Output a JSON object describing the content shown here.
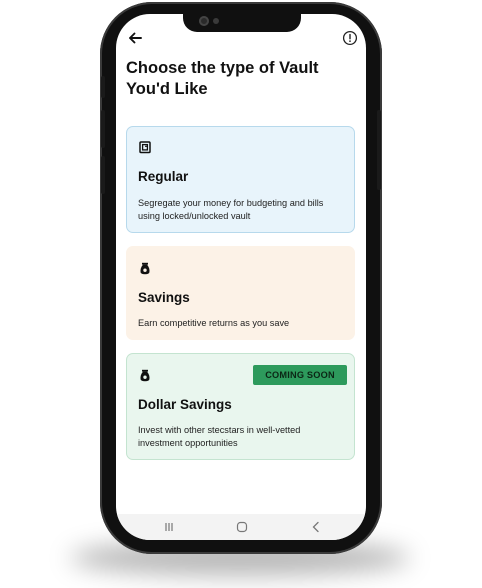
{
  "header": {
    "back_icon": "arrow-left-icon",
    "info_icon": "info-circle-icon",
    "title": "Choose the type of Vault You'd Like"
  },
  "vault_options": [
    {
      "title": "Regular",
      "description": "Segregate your money for budgeting and bills using locked/unlocked vault",
      "icon": "regular-vault-icon",
      "background": "#e8f4fb",
      "border": "#b7d9ec"
    },
    {
      "title": "Savings",
      "description": "Earn competitive returns as you save",
      "icon": "money-bag-icon",
      "background": "#fcf2e7",
      "border": "#fcf2e7"
    },
    {
      "title": "Dollar Savings",
      "description": "Invest with other stecstars in well-vetted investment opportunities",
      "icon": "money-bag-icon",
      "badge": "COMING SOON",
      "badge_color": "#2d9a5c",
      "background": "#e9f6ee",
      "border": "#c4e4d0"
    }
  ],
  "nav_bar": {
    "recents_icon": "recents-icon",
    "home_icon": "home-icon",
    "back_icon": "back-chevron-icon"
  }
}
